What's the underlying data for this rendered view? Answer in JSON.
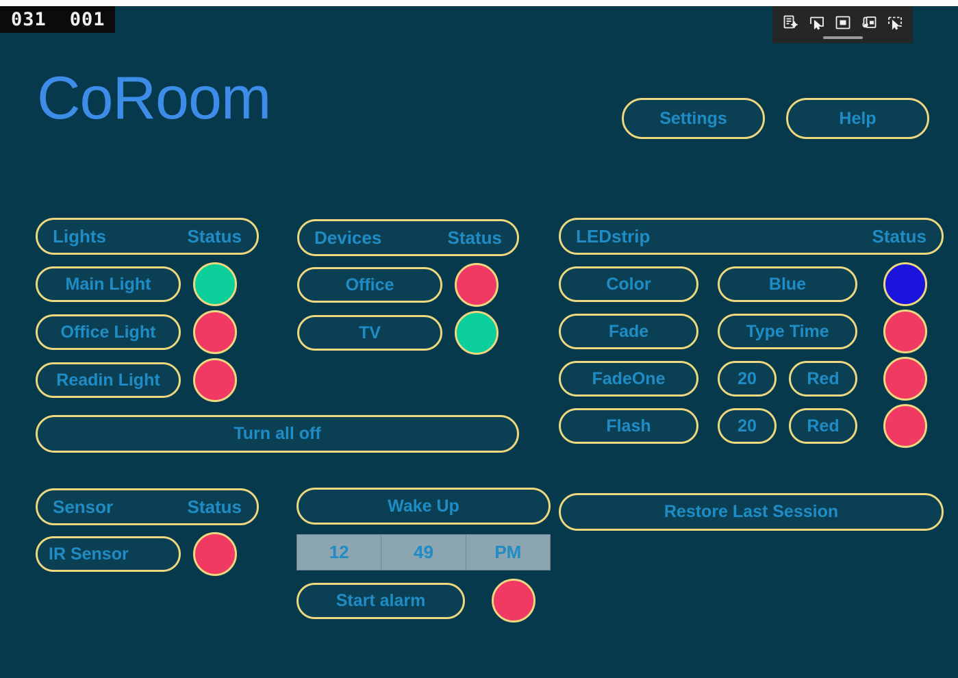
{
  "status_bar": {
    "counter_left": "031",
    "counter_right": "001",
    "toolbar_icons": [
      "snip-new-icon",
      "rectangular-snip-icon",
      "window-snip-icon",
      "fullscreen-snip-icon",
      "freeform-snip-icon"
    ]
  },
  "header": {
    "title": "CoRoom",
    "settings_label": "Settings",
    "help_label": "Help"
  },
  "lights": {
    "header_title": "Lights",
    "header_status": "Status",
    "rows": [
      {
        "label": "Main Light",
        "status": "green"
      },
      {
        "label": "Office Light",
        "status": "red"
      },
      {
        "label": "Readin Light",
        "status": "red"
      }
    ],
    "turn_all_off": "Turn all off"
  },
  "devices": {
    "header_title": "Devices",
    "header_status": "Status",
    "rows": [
      {
        "label": "Office",
        "status": "red"
      },
      {
        "label": "TV",
        "status": "green"
      }
    ]
  },
  "ledstrip": {
    "header_title": "LEDstrip",
    "header_status": "Status",
    "rows": [
      {
        "mode": "Color",
        "arg1": "Blue",
        "arg2": "",
        "arg3": "",
        "status": "blue"
      },
      {
        "mode": "Fade",
        "arg1": "Type Time",
        "arg2": "",
        "arg3": "",
        "status": "red"
      },
      {
        "mode": "FadeOne",
        "arg1": "",
        "arg2": "20",
        "arg3": "Red",
        "status": "red"
      },
      {
        "mode": "Flash",
        "arg1": "",
        "arg2": "20",
        "arg3": "Red",
        "status": "red"
      }
    ]
  },
  "sensor": {
    "header_title": "Sensor",
    "header_status": "Status",
    "rows": [
      {
        "label": "IR  Sensor",
        "status": "red"
      }
    ]
  },
  "alarm": {
    "wake_up_label": "Wake Up",
    "time": {
      "hour": "12",
      "minute": "49",
      "meridiem": "PM"
    },
    "start_alarm_label": "Start alarm",
    "alarm_status": "red"
  },
  "session": {
    "restore_label": "Restore Last Session"
  },
  "colors": {
    "background": "#07394c",
    "pill_border": "#edd77f",
    "pill_fill": "#0b4054",
    "text": "#1f8cc6",
    "title": "#3d8ce8",
    "status_green": "#0ccf9b",
    "status_red": "#f03a63",
    "status_blue": "#1a14dd",
    "timepicker_bg": "#8ba5b1"
  }
}
